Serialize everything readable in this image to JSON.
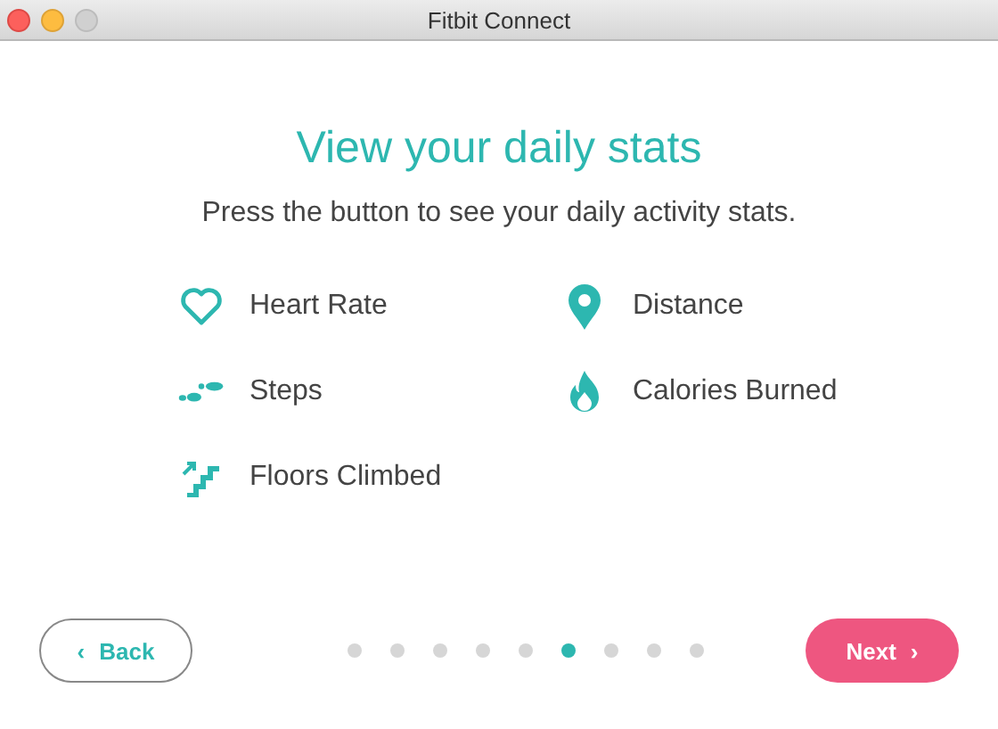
{
  "window": {
    "title": "Fitbit Connect"
  },
  "heading": "View your daily stats",
  "subtitle": "Press the button to see your daily activity stats.",
  "stats": [
    {
      "kind": "heart",
      "label": "Heart Rate"
    },
    {
      "kind": "pin",
      "label": "Distance"
    },
    {
      "kind": "steps",
      "label": "Steps"
    },
    {
      "kind": "flame",
      "label": "Calories Burned"
    },
    {
      "kind": "stairs",
      "label": "Floors Climbed"
    }
  ],
  "back_button": {
    "icon": "‹",
    "label": "Back"
  },
  "next_button": {
    "label": "Next",
    "icon": "›"
  },
  "pager": [
    {
      "selected": false
    },
    {
      "selected": false
    },
    {
      "selected": false
    },
    {
      "selected": false
    },
    {
      "selected": false
    },
    {
      "selected": true
    },
    {
      "selected": false
    },
    {
      "selected": false
    },
    {
      "selected": false
    }
  ]
}
